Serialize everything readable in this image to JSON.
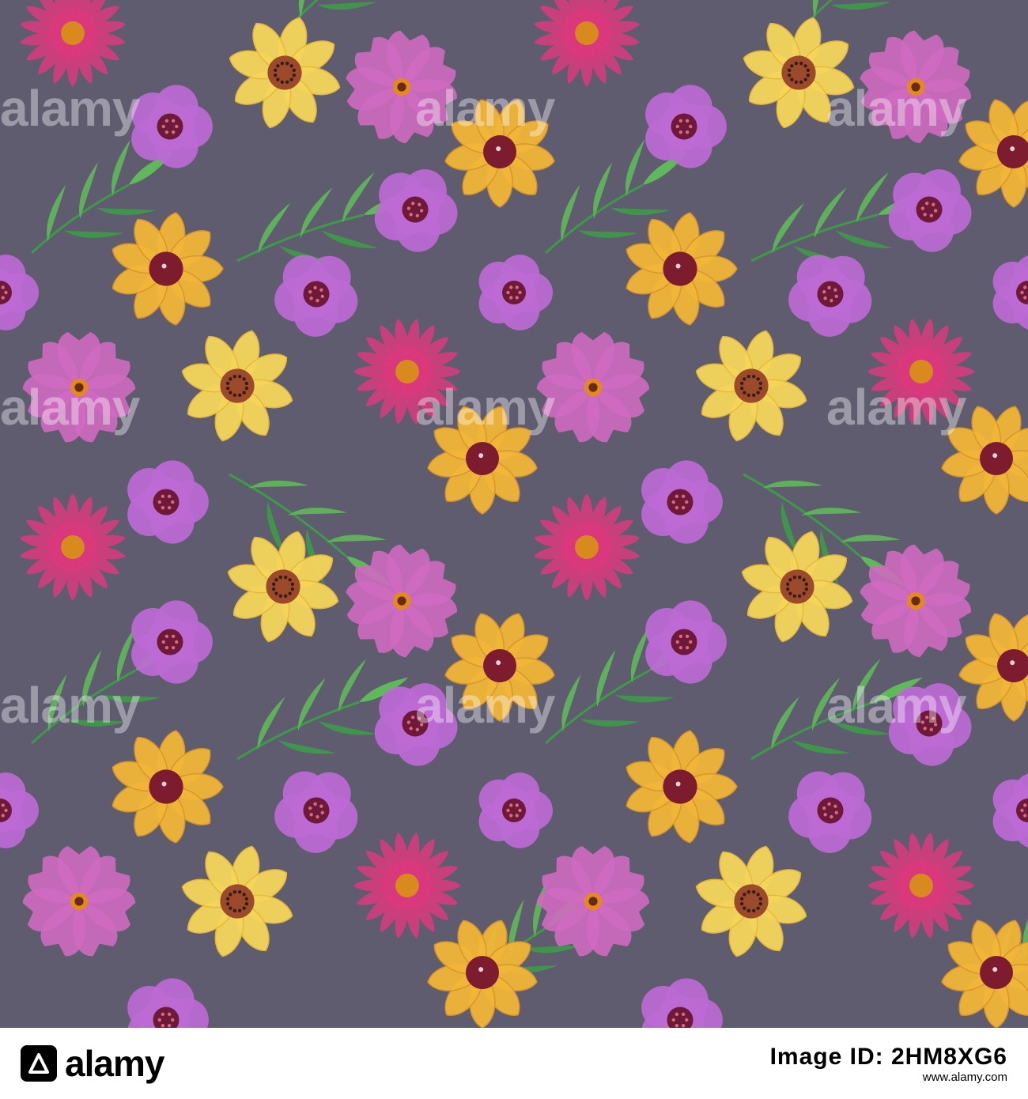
{
  "pattern": {
    "background": "#5f5c70",
    "colors": {
      "yellow_petal": "#f5d65a",
      "yellow_petal_edge": "#e7b93a",
      "yellow_center": "#9b4a2c",
      "orange_yellow_petal": "#f2b638",
      "maroon_center": "#7c1c2e",
      "magenta_petal": "#d93a7c",
      "magenta_center": "#d98a1e",
      "pink_petal": "#cf6ac0",
      "violet_petal": "#bd6ad4",
      "violet_center": "#6d1a3a",
      "leaf": "#5fb85a",
      "leaf_dark": "#3e9a48"
    },
    "flower_types": [
      "yellow-daisy",
      "orange-daisy",
      "magenta-aster",
      "pink-cosmos",
      "violet-blossom",
      "leaf-sprig"
    ]
  },
  "watermark": {
    "text": "alamy"
  },
  "footer": {
    "logo_text": "alamy",
    "image_id_label": "Image ID: 2HM8XG6",
    "site": "www.alamy.com"
  }
}
